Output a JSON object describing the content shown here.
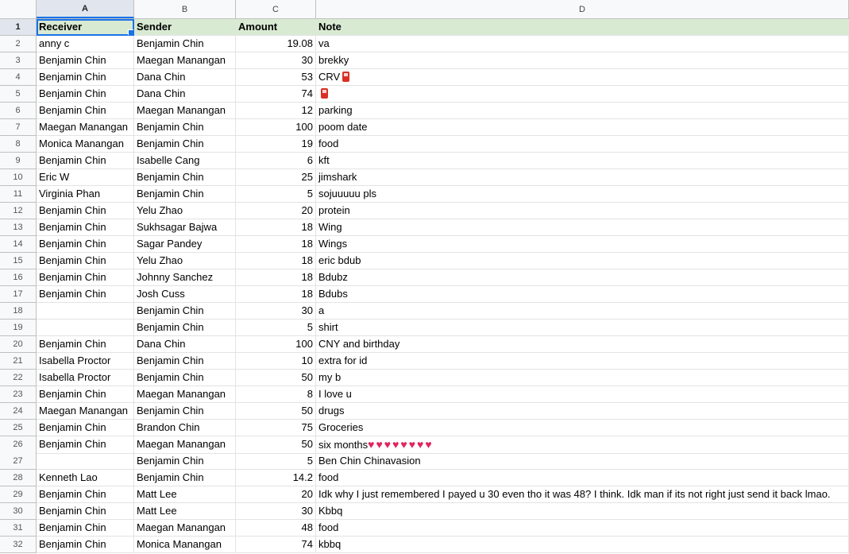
{
  "columns": [
    "A",
    "B",
    "C",
    "D"
  ],
  "header": {
    "row": "1",
    "receiver": "Receiver",
    "sender": "Sender",
    "amount": "Amount",
    "note": "Note"
  },
  "rows": [
    {
      "n": "2",
      "a": "anny c",
      "b": "Benjamin Chin",
      "c": "19.08",
      "d": "va"
    },
    {
      "n": "3",
      "a": "Benjamin Chin",
      "b": "Maegan Manangan",
      "c": "30",
      "d": "brekky"
    },
    {
      "n": "4",
      "a": "Benjamin Chin",
      "b": "Dana Chin",
      "c": "53",
      "d": "CRV",
      "icon": "fuel-pump-icon"
    },
    {
      "n": "5",
      "a": "Benjamin Chin",
      "b": "Dana Chin",
      "c": "74",
      "d": "",
      "icon": "fuel-pump-icon"
    },
    {
      "n": "6",
      "a": "Benjamin Chin",
      "b": "Maegan Manangan",
      "c": "12",
      "d": "parking"
    },
    {
      "n": "7",
      "a": "Maegan Manangan",
      "b": "Benjamin Chin",
      "c": "100",
      "d": "poom date"
    },
    {
      "n": "8",
      "a": "Monica Manangan",
      "b": "Benjamin Chin",
      "c": "19",
      "d": "food"
    },
    {
      "n": "9",
      "a": "Benjamin Chin",
      "b": "Isabelle Cang",
      "c": "6",
      "d": "kft"
    },
    {
      "n": "10",
      "a": "Eric W",
      "b": "Benjamin Chin",
      "c": "25",
      "d": "jimshark"
    },
    {
      "n": "11",
      "a": "Virginia Phan",
      "b": "Benjamin Chin",
      "c": "5",
      "d": "sojuuuuu pls"
    },
    {
      "n": "12",
      "a": "Benjamin Chin",
      "b": "Yelu Zhao",
      "c": "20",
      "d": "protein"
    },
    {
      "n": "13",
      "a": "Benjamin Chin",
      "b": "Sukhsagar Bajwa",
      "c": "18",
      "d": "Wing"
    },
    {
      "n": "14",
      "a": "Benjamin Chin",
      "b": "Sagar Pandey",
      "c": "18",
      "d": "Wings"
    },
    {
      "n": "15",
      "a": "Benjamin Chin",
      "b": "Yelu Zhao",
      "c": "18",
      "d": "eric bdub"
    },
    {
      "n": "16",
      "a": "Benjamin Chin",
      "b": "Johnny Sanchez",
      "c": "18",
      "d": "Bdubz"
    },
    {
      "n": "17",
      "a": "Benjamin Chin",
      "b": "Josh Cuss",
      "c": "18",
      "d": "Bdubs"
    },
    {
      "n": "18",
      "a": "",
      "b": "Benjamin Chin",
      "c": "30",
      "d": "a"
    },
    {
      "n": "19",
      "a": "",
      "b": "Benjamin Chin",
      "c": "5",
      "d": "shirt"
    },
    {
      "n": "20",
      "a": "Benjamin Chin",
      "b": "Dana Chin",
      "c": "100",
      "d": "CNY and birthday"
    },
    {
      "n": "21",
      "a": "Isabella Proctor",
      "b": "Benjamin Chin",
      "c": "10",
      "d": "extra for id"
    },
    {
      "n": "22",
      "a": "Isabella Proctor",
      "b": "Benjamin Chin",
      "c": "50",
      "d": "my b"
    },
    {
      "n": "23",
      "a": "Benjamin Chin",
      "b": "Maegan Manangan",
      "c": "8",
      "d": "I love u"
    },
    {
      "n": "24",
      "a": "Maegan Manangan",
      "b": "Benjamin Chin",
      "c": "50",
      "d": "drugs"
    },
    {
      "n": "25",
      "a": "Benjamin Chin",
      "b": "Brandon Chin",
      "c": "75",
      "d": "Groceries"
    },
    {
      "n": "26",
      "a": "Benjamin Chin",
      "b": "Maegan Manangan",
      "c": "50",
      "d": "six months",
      "hearts": "♥♥♥♥♥♥♥♥"
    },
    {
      "n": "27",
      "a": "",
      "b": "Benjamin Chin",
      "c": "5",
      "d": "Ben Chin Chinavasion"
    },
    {
      "n": "28",
      "a": "Kenneth Lao",
      "b": "Benjamin Chin",
      "c": "14.2",
      "d": "food"
    },
    {
      "n": "29",
      "a": "Benjamin Chin",
      "b": "Matt Lee",
      "c": "20",
      "d": "Idk why I just remembered I payed u 30 even tho it was 48? I think. Idk man if its not right just send it back lmao."
    },
    {
      "n": "30",
      "a": "Benjamin Chin",
      "b": "Matt Lee",
      "c": "30",
      "d": "Kbbq"
    },
    {
      "n": "31",
      "a": "Benjamin Chin",
      "b": "Maegan Manangan",
      "c": "48",
      "d": "food"
    },
    {
      "n": "32",
      "a": "Benjamin Chin",
      "b": "Monica Manangan",
      "c": "74",
      "d": "kbbq"
    }
  ],
  "colors": {
    "header_fill": "#d9ead3",
    "selection": "#1a73e8",
    "heart": "#e0245e"
  }
}
